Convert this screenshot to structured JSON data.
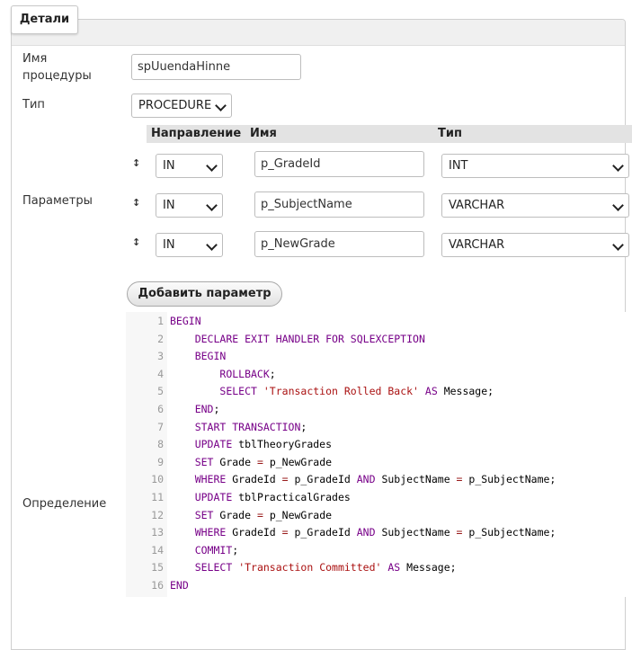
{
  "panel": {
    "legend": "Детали"
  },
  "form": {
    "name_label": "Имя процедуры",
    "name_value": "spUuendaHinne",
    "type_label": "Тип",
    "type_value": "PROCEDURE",
    "params_label": "Параметры",
    "definition_label": "Определение",
    "add_param_label": "Добавить параметр"
  },
  "params": {
    "headers": {
      "direction": "Направление",
      "name": "Имя",
      "type": "Тип"
    },
    "rows": [
      {
        "direction": "IN",
        "name": "p_GradeId",
        "type": "INT"
      },
      {
        "direction": "IN",
        "name": "p_SubjectName",
        "type": "VARCHAR"
      },
      {
        "direction": "IN",
        "name": "p_NewGrade",
        "type": "VARCHAR"
      }
    ]
  },
  "code": {
    "lines": [
      {
        "num": "1",
        "tokens": [
          [
            "kw",
            "BEGIN"
          ]
        ]
      },
      {
        "num": "2",
        "tokens": [
          [
            "plain",
            "    "
          ],
          [
            "kw",
            "DECLARE EXIT HANDLER FOR SQLEXCEPTION"
          ]
        ]
      },
      {
        "num": "3",
        "tokens": [
          [
            "plain",
            "    "
          ],
          [
            "kw",
            "BEGIN"
          ]
        ]
      },
      {
        "num": "4",
        "tokens": [
          [
            "plain",
            "        "
          ],
          [
            "kw",
            "ROLLBACK"
          ],
          [
            "plain",
            ";"
          ]
        ]
      },
      {
        "num": "5",
        "tokens": [
          [
            "plain",
            "        "
          ],
          [
            "kw",
            "SELECT"
          ],
          [
            "plain",
            " "
          ],
          [
            "str",
            "'Transaction Rolled Back'"
          ],
          [
            "plain",
            " "
          ],
          [
            "kw",
            "AS"
          ],
          [
            "plain",
            " Message;"
          ]
        ]
      },
      {
        "num": "6",
        "tokens": [
          [
            "plain",
            "    "
          ],
          [
            "kw",
            "END"
          ],
          [
            "plain",
            ";"
          ]
        ]
      },
      {
        "num": "7",
        "tokens": [
          [
            "plain",
            "    "
          ],
          [
            "kw",
            "START TRANSACTION"
          ],
          [
            "plain",
            ";"
          ]
        ]
      },
      {
        "num": "8",
        "tokens": [
          [
            "plain",
            "    "
          ],
          [
            "kw",
            "UPDATE"
          ],
          [
            "plain",
            " tblTheoryGrades"
          ]
        ]
      },
      {
        "num": "9",
        "tokens": [
          [
            "plain",
            "    "
          ],
          [
            "kw",
            "SET"
          ],
          [
            "plain",
            " Grade "
          ],
          [
            "op",
            "="
          ],
          [
            "plain",
            " p_NewGrade"
          ]
        ]
      },
      {
        "num": "10",
        "tokens": [
          [
            "plain",
            "    "
          ],
          [
            "kw",
            "WHERE"
          ],
          [
            "plain",
            " GradeId "
          ],
          [
            "op",
            "="
          ],
          [
            "plain",
            " p_GradeId "
          ],
          [
            "kw",
            "AND"
          ],
          [
            "plain",
            " SubjectName "
          ],
          [
            "op",
            "="
          ],
          [
            "plain",
            " p_SubjectName;"
          ]
        ]
      },
      {
        "num": "11",
        "tokens": [
          [
            "plain",
            "    "
          ],
          [
            "kw",
            "UPDATE"
          ],
          [
            "plain",
            " tblPracticalGrades"
          ]
        ]
      },
      {
        "num": "12",
        "tokens": [
          [
            "plain",
            "    "
          ],
          [
            "kw",
            "SET"
          ],
          [
            "plain",
            " Grade "
          ],
          [
            "op",
            "="
          ],
          [
            "plain",
            " p_NewGrade"
          ]
        ]
      },
      {
        "num": "13",
        "tokens": [
          [
            "plain",
            "    "
          ],
          [
            "kw",
            "WHERE"
          ],
          [
            "plain",
            " GradeId "
          ],
          [
            "op",
            "="
          ],
          [
            "plain",
            " p_GradeId "
          ],
          [
            "kw",
            "AND"
          ],
          [
            "plain",
            " SubjectName "
          ],
          [
            "op",
            "="
          ],
          [
            "plain",
            " p_SubjectName;"
          ]
        ]
      },
      {
        "num": "14",
        "tokens": [
          [
            "plain",
            "    "
          ],
          [
            "kw",
            "COMMIT"
          ],
          [
            "plain",
            ";"
          ]
        ]
      },
      {
        "num": "15",
        "tokens": [
          [
            "plain",
            "    "
          ],
          [
            "kw",
            "SELECT"
          ],
          [
            "plain",
            " "
          ],
          [
            "str",
            "'Transaction Committed'"
          ],
          [
            "plain",
            " "
          ],
          [
            "kw",
            "AS"
          ],
          [
            "plain",
            " Message;"
          ]
        ]
      },
      {
        "num": "16",
        "tokens": [
          [
            "kw",
            "END"
          ]
        ]
      }
    ]
  }
}
